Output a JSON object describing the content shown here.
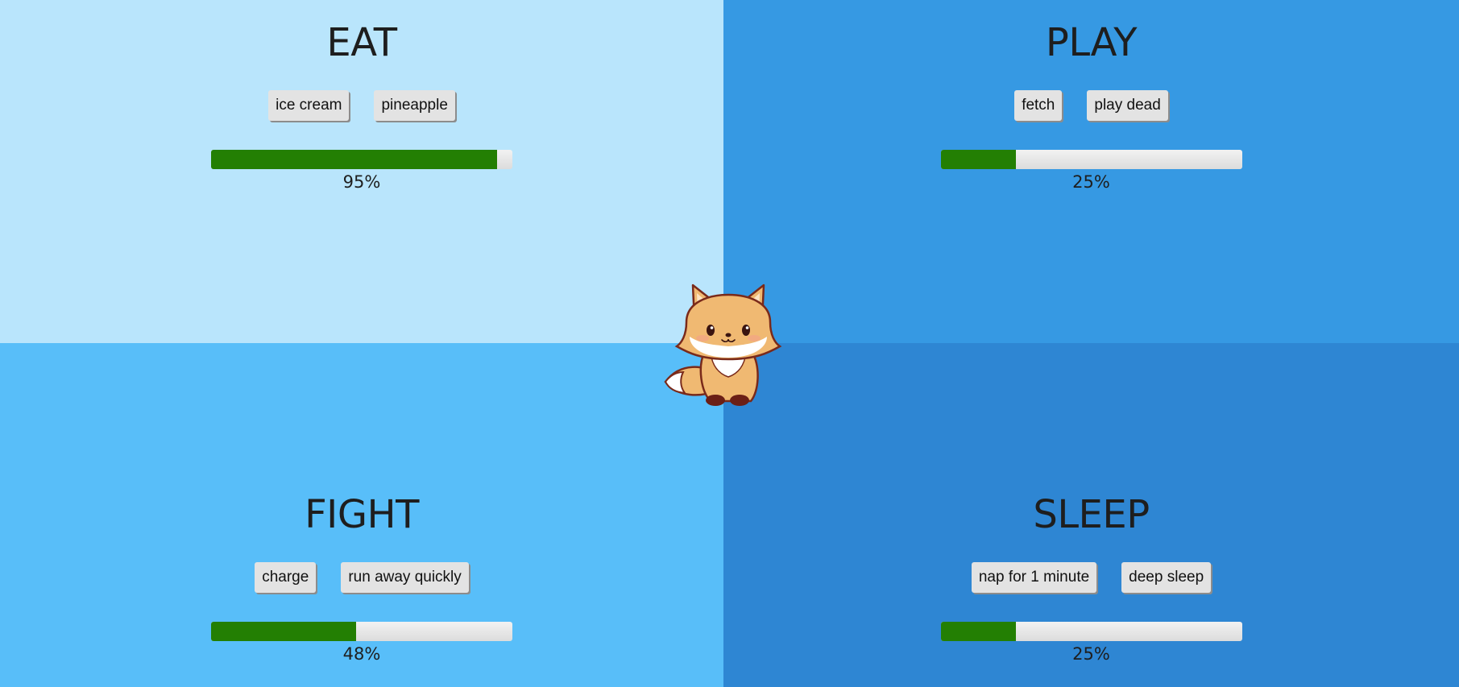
{
  "colors": {
    "eat_bg": "#b9e5fc",
    "play_bg": "#3699e3",
    "fight_bg": "#58bef9",
    "sleep_bg": "#2e86d3",
    "progress_fill": "#237f03",
    "progress_track": "#e6e6e6"
  },
  "sections": {
    "eat": {
      "title": "EAT",
      "actions": [
        "ice cream",
        "pineapple"
      ],
      "progress": 0.95,
      "percent_label": "95%"
    },
    "play": {
      "title": "PLAY",
      "actions": [
        "fetch",
        "play dead"
      ],
      "progress": 0.25,
      "percent_label": "25%"
    },
    "fight": {
      "title": "FIGHT",
      "actions": [
        "charge",
        "run away quickly"
      ],
      "progress": 0.48,
      "percent_label": "48%"
    },
    "sleep": {
      "title": "SLEEP",
      "actions": [
        "nap for 1 minute",
        "deep sleep"
      ],
      "progress": 0.25,
      "percent_label": "25%"
    }
  },
  "pet": {
    "icon": "fox-icon"
  }
}
